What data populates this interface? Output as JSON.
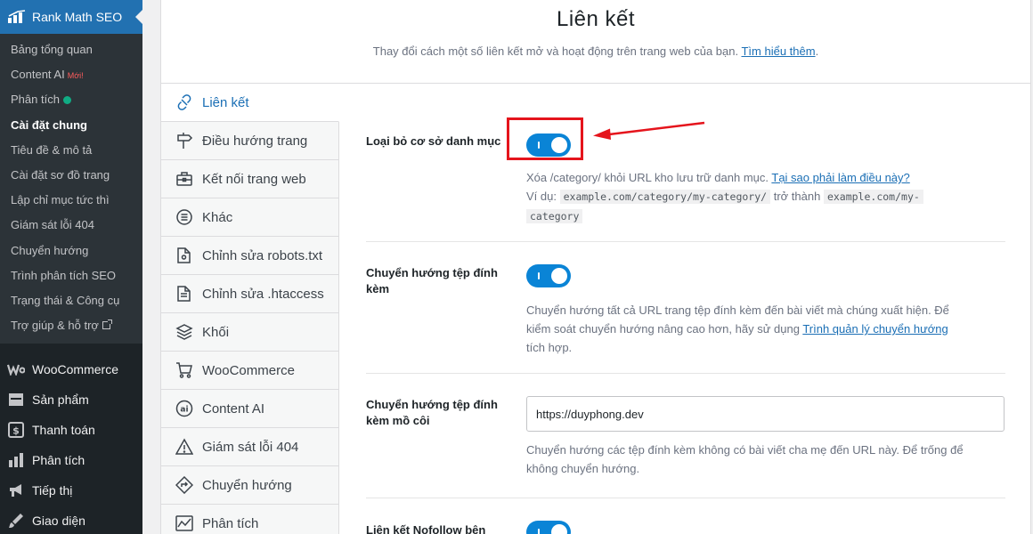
{
  "sidebar": {
    "plugin_title": "Rank Math SEO",
    "submenu": [
      {
        "label": "Bảng tổng quan"
      },
      {
        "label": "Content AI",
        "badge": "Mới!"
      },
      {
        "label": "Phân tích"
      },
      {
        "label": "Cài đặt chung",
        "current": true
      },
      {
        "label": "Tiêu đề & mô tả"
      },
      {
        "label": "Cài đặt sơ đồ trang"
      },
      {
        "label": "Lập chỉ mục tức thì"
      },
      {
        "label": "Giám sát lỗi 404"
      },
      {
        "label": "Chuyển hướng"
      },
      {
        "label": "Trình phân tích SEO"
      },
      {
        "label": "Trạng thái & Công cụ"
      },
      {
        "label": "Trợ giúp & hỗ trợ"
      }
    ],
    "menu": [
      {
        "label": "WooCommerce",
        "icon": "woocommerce-icon"
      },
      {
        "label": "Sản phẩm",
        "icon": "products-icon"
      },
      {
        "label": "Thanh toán",
        "icon": "payments-icon"
      },
      {
        "label": "Phân tích",
        "icon": "analytics-icon"
      },
      {
        "label": "Tiếp thị",
        "icon": "megaphone-icon"
      },
      {
        "label": "Giao diện",
        "icon": "paintbrush-icon"
      }
    ]
  },
  "header": {
    "title": "Liên kết",
    "description": "Thay đổi cách một số liên kết mở và hoạt động trên trang web của bạn.",
    "learn_more": "Tìm hiểu thêm",
    "period": "."
  },
  "tabs": [
    {
      "label": "Liên kết",
      "icon": "link-icon",
      "active": true
    },
    {
      "label": "Điều hướng trang",
      "icon": "signpost-icon"
    },
    {
      "label": "Kết nối trang web",
      "icon": "toolbox-icon"
    },
    {
      "label": "Khác",
      "icon": "list-circle-icon"
    },
    {
      "label": "Chỉnh sửa robots.txt",
      "icon": "folder-icon"
    },
    {
      "label": "Chỉnh sửa .htaccess",
      "icon": "file-icon"
    },
    {
      "label": "Khối",
      "icon": "blocks-icon"
    },
    {
      "label": "WooCommerce",
      "icon": "cart-icon"
    },
    {
      "label": "Content AI",
      "icon": "content-ai-icon"
    },
    {
      "label": "Giám sát lỗi 404",
      "icon": "warning-icon"
    },
    {
      "label": "Chuyển hướng",
      "icon": "redirect-icon"
    },
    {
      "label": "Phân tích",
      "icon": "chart-icon"
    }
  ],
  "settings": {
    "strip_category": {
      "label": "Loại bỏ cơ sở danh mục",
      "enabled": true,
      "desc": "Xóa /category/ khỏi URL kho lưu trữ danh mục.",
      "desc_link": "Tại sao phải làm điều này?",
      "example_prefix": "Ví dụ:",
      "example_from": "example.com/category/my-category/",
      "example_mid": "trở thành",
      "example_to_1": "example.com/my-",
      "example_to_2": "category"
    },
    "redirect_attachments": {
      "label_1": "Chuyển hướng tệp đính",
      "label_2": "kèm",
      "enabled": true,
      "desc_1": "Chuyển hướng tất cả URL trang tệp đính kèm đến bài viết mà chúng xuất hiện. Để",
      "desc_2": "kiểm soát chuyển hướng nâng cao hơn, hãy sử dụng",
      "desc_link": "Trình quản lý chuyển hướng",
      "desc_3": "tích hợp."
    },
    "orphan_attachments": {
      "label_1": "Chuyển hướng tệp đính",
      "label_2": "kèm mồ côi",
      "value": "https://duyphong.dev",
      "desc_1": "Chuyển hướng các tệp đính kèm không có bài viết cha mẹ đến URL này. Để trống để",
      "desc_2": "không chuyển hướng."
    },
    "nofollow": {
      "label": "Liên kết Nofollow bên",
      "enabled": true
    }
  },
  "colors": {
    "accent": "#2271b1",
    "toggle_on": "#0a84d6",
    "highlight": "#e5141c"
  }
}
